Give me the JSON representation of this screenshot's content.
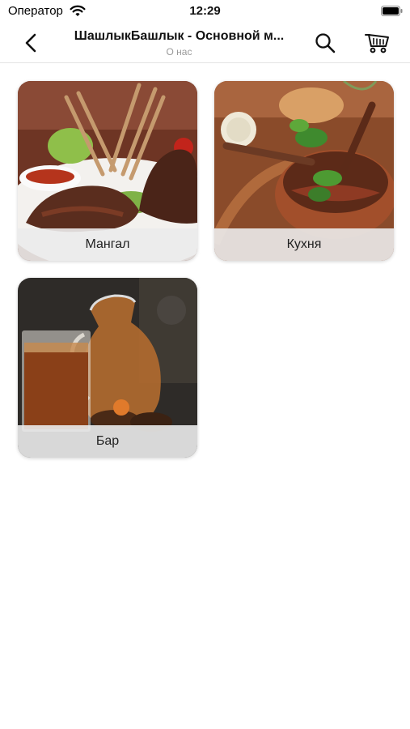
{
  "status_bar": {
    "carrier": "Оператор",
    "time": "12:29"
  },
  "nav": {
    "title": "ШашлыкБашлык - Основной м...",
    "subtitle": "О нас"
  },
  "icons": {
    "back": "chevron-left-icon",
    "search": "search-icon",
    "cart": "shopping-basket-icon"
  },
  "categories": [
    {
      "label": "Мангал",
      "image": "grilled-lamb-chops-photo"
    },
    {
      "label": "Кухня",
      "image": "lamb-in-clay-bowl-photo"
    },
    {
      "label": "Бар",
      "image": "kvass-jug-and-glass-photo"
    }
  ]
}
